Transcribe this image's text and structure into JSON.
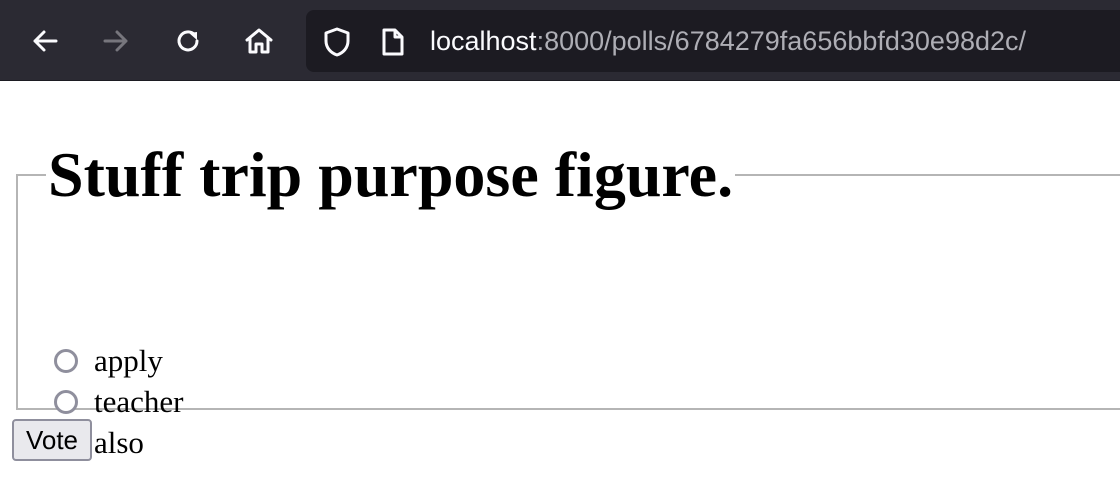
{
  "browser": {
    "url_host": "localhost",
    "url_rest": ":8000/polls/6784279fa656bbfd30e98d2c/",
    "icons": {
      "back": "arrow-left-icon",
      "forward": "arrow-right-icon",
      "reload": "reload-icon",
      "home": "home-icon",
      "shield": "shield-icon",
      "page": "page-icon"
    }
  },
  "poll": {
    "title": "Stuff trip purpose figure.",
    "choices": [
      {
        "label": "apply",
        "selected": false
      },
      {
        "label": "teacher",
        "selected": false
      },
      {
        "label": "also",
        "selected": false
      }
    ],
    "vote_label": "Vote"
  },
  "colors": {
    "toolbar_bg": "#2b2a33",
    "urlbar_bg": "#1c1b22",
    "radio_border": "#8f8f9d",
    "fieldset_border": "#b5b5b5"
  }
}
